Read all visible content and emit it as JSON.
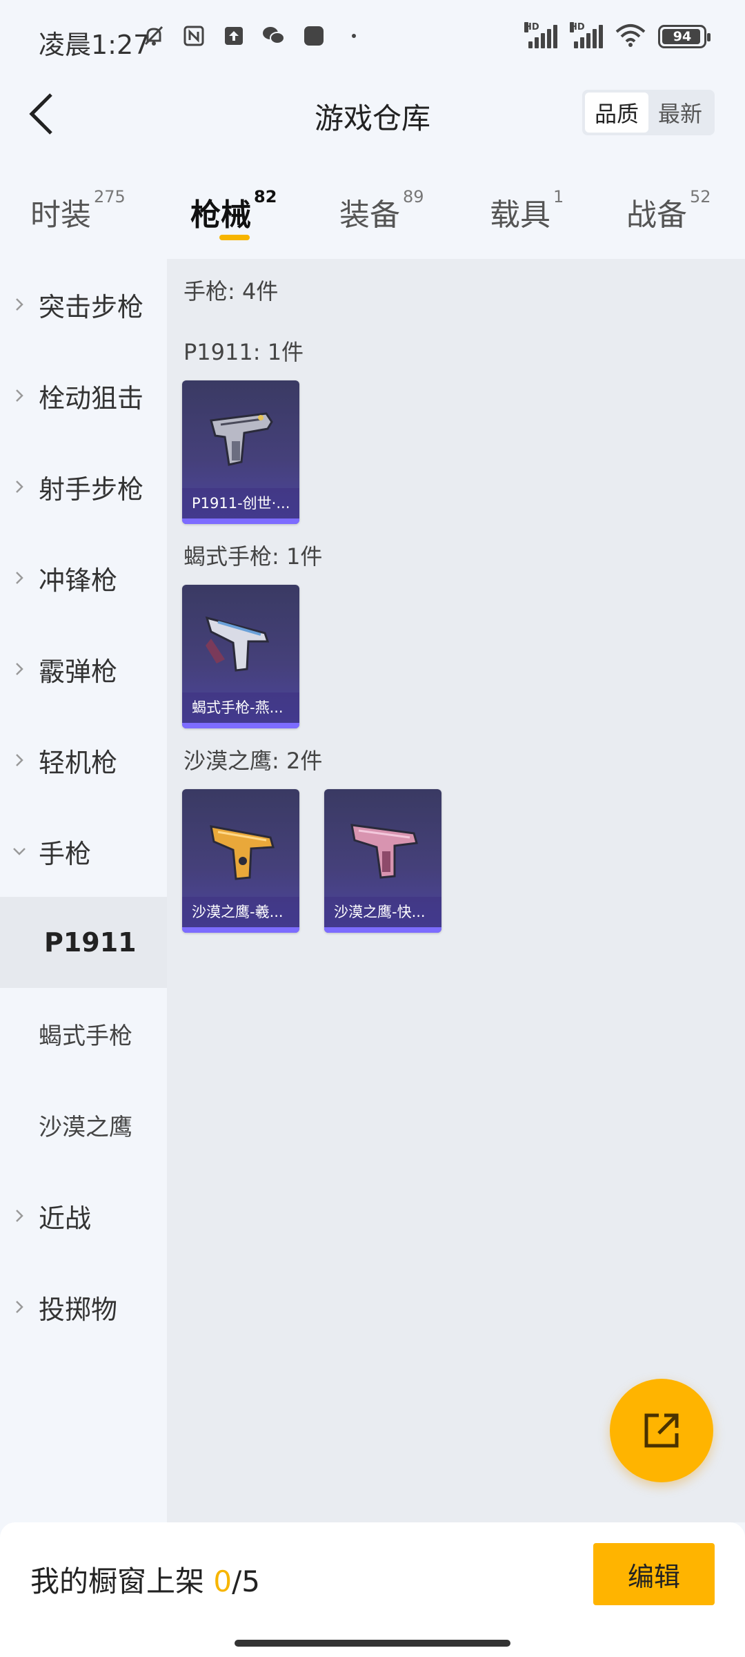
{
  "status": {
    "time": "凌晨1:27",
    "battery": "94",
    "signal_tag": "HD",
    "colors": {
      "battery_fill": "#444444"
    }
  },
  "header": {
    "title": "游戏仓库",
    "sort_options": [
      "品质",
      "最新"
    ],
    "sort_selected": "品质"
  },
  "tabs": [
    {
      "label": "时装",
      "count": "275"
    },
    {
      "label": "枪械",
      "count": "82"
    },
    {
      "label": "装备",
      "count": "89"
    },
    {
      "label": "载具",
      "count": "1"
    },
    {
      "label": "战备",
      "count": "52"
    }
  ],
  "active_tab": "枪械",
  "nav": {
    "items": [
      "突击步枪",
      "栓动狙击",
      "射手步枪",
      "冲锋枪",
      "霰弹枪",
      "轻机枪",
      "手枪",
      "P1911",
      "蝎式手枪",
      "沙漠之鹰",
      "近战",
      "投掷物"
    ],
    "expanded": "手枪",
    "selected_sub": "P1911"
  },
  "content": {
    "summary": "手枪: 4件",
    "groups": [
      {
        "title": "P1911: 1件",
        "items": [
          "P1911-创世·..."
        ]
      },
      {
        "title": "蝎式手枪: 1件",
        "items": [
          "蝎式手枪-燕..."
        ]
      },
      {
        "title": "沙漠之鹰: 2件",
        "items": [
          "沙漠之鹰-羲...",
          "沙漠之鹰-快..."
        ]
      }
    ]
  },
  "bottom": {
    "shelf_label": "我的橱窗上架 ",
    "shelf_current": "0",
    "shelf_total": "/5",
    "edit_label": "编辑"
  },
  "colors": {
    "accent": "#ffb400",
    "card_bg": "#45407a",
    "card_bar": "#7d6cff",
    "content_bg": "#e9ecf1",
    "page_bg": "#f3f6fb"
  },
  "icons": [
    "bell-off-icon",
    "nfc-icon",
    "upload-icon",
    "wechat-icon",
    "app-icon",
    "signal-icon",
    "wifi-icon",
    "battery-icon",
    "back-arrow-icon",
    "chevron-right-icon",
    "chevron-down-icon",
    "share-icon"
  ]
}
